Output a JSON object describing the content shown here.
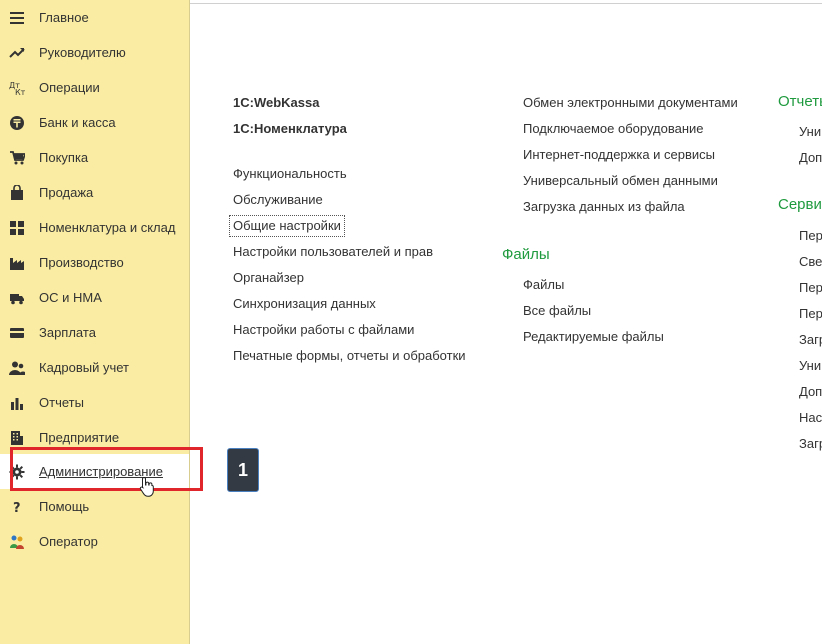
{
  "sidebar": {
    "items": [
      {
        "label": "Главное",
        "icon": "menu-lines-icon"
      },
      {
        "label": "Руководителю",
        "icon": "trend-chart-icon"
      },
      {
        "label": "Операции",
        "icon": "debit-credit-icon"
      },
      {
        "label": "Банк и касса",
        "icon": "tenge-coin-icon"
      },
      {
        "label": "Покупка",
        "icon": "shopping-cart-icon"
      },
      {
        "label": "Продажа",
        "icon": "shopping-bag-icon"
      },
      {
        "label": "Номенклатура и склад",
        "icon": "grid-blocks-icon"
      },
      {
        "label": "Производство",
        "icon": "factory-icon"
      },
      {
        "label": "ОС и НМА",
        "icon": "truck-icon"
      },
      {
        "label": "Зарплата",
        "icon": "wallet-card-icon"
      },
      {
        "label": "Кадровый учет",
        "icon": "people-icon"
      },
      {
        "label": "Отчеты",
        "icon": "bar-chart-icon"
      },
      {
        "label": "Предприятие",
        "icon": "building-icon"
      },
      {
        "label": "Администрирование",
        "icon": "gear-icon"
      },
      {
        "label": "Помощь",
        "icon": "question-icon"
      },
      {
        "label": "Оператор",
        "icon": "operator-icon"
      }
    ],
    "active_index": 13
  },
  "annotation": {
    "step_number": "1"
  },
  "content": {
    "col1_top": [
      "1С:WebKassa",
      "1С:Номенклатура"
    ],
    "col1_links": [
      "Функциональность",
      "Обслуживание",
      "Общие настройки",
      "Настройки пользователей и прав",
      "Органайзер",
      "Синхронизация данных",
      "Настройки работы с файлами",
      "Печатные формы, отчеты и обработки"
    ],
    "col2_links": [
      "Обмен электронными документами",
      "Подключаемое оборудование",
      "Интернет-поддержка и сервисы",
      "Универсальный обмен данными",
      "Загрузка данных из файла"
    ],
    "files_section": {
      "title": "Файлы",
      "links": [
        "Файлы",
        "Все файлы",
        "Редактируемые файлы"
      ]
    },
    "reports_section": {
      "title": "Отчеты",
      "links": [
        "Уни",
        "Доп"
      ]
    },
    "services_section": {
      "title": "Серви",
      "links": [
        "Пер",
        "Све",
        "Пер",
        "Пер",
        "Загр",
        "Уни",
        "Доп",
        "Нас",
        "Загр"
      ]
    }
  },
  "colors": {
    "sidebar_bg": "#faeda3",
    "section_title": "#1f9a3e",
    "highlight": "#e0262b"
  }
}
